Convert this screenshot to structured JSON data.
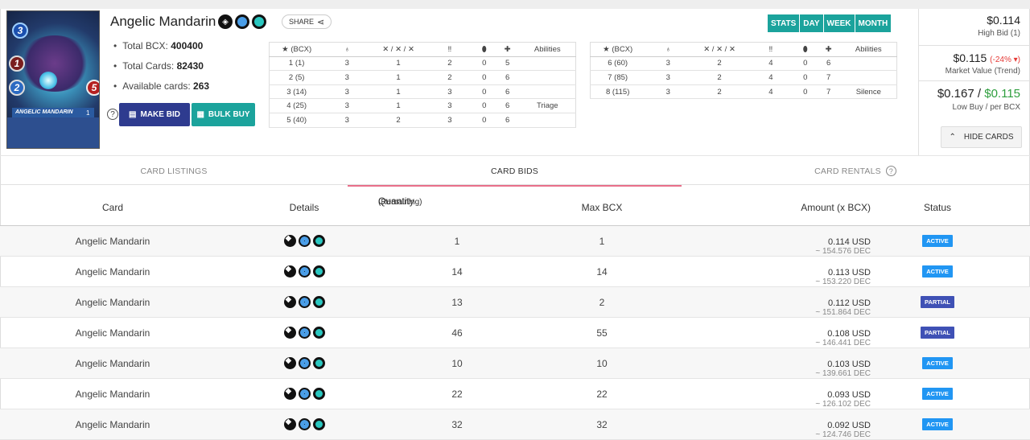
{
  "card": {
    "title": "Angelic Mandarin",
    "art_name": "ANGELIC MANDARIN",
    "art_mana": "3",
    "art_melee": "1",
    "art_speed": "2",
    "art_health": "5",
    "art_level": "1",
    "share_label": "SHARE",
    "total_bcx_label": "Total BCX:",
    "total_bcx": "400400",
    "total_cards_label": "Total Cards:",
    "total_cards": "82430",
    "available_label": "Available cards:",
    "available": "263",
    "make_bid_label": "MAKE BID",
    "bulk_buy_label": "BULK BUY"
  },
  "level_table_headers": [
    "(BCX)",
    "",
    "/ /",
    "",
    "",
    "",
    "Abilities"
  ],
  "level_table_1": [
    [
      "1 (1)",
      "3",
      "1",
      "2",
      "0",
      "5",
      ""
    ],
    [
      "2 (5)",
      "3",
      "1",
      "2",
      "0",
      "6",
      ""
    ],
    [
      "3 (14)",
      "3",
      "1",
      "3",
      "0",
      "6",
      ""
    ],
    [
      "4 (25)",
      "3",
      "1",
      "3",
      "0",
      "6",
      "Triage"
    ],
    [
      "5 (40)",
      "3",
      "2",
      "3",
      "0",
      "6",
      ""
    ]
  ],
  "level_table_2": [
    [
      "6 (60)",
      "3",
      "2",
      "4",
      "0",
      "6",
      ""
    ],
    [
      "7 (85)",
      "3",
      "2",
      "4",
      "0",
      "7",
      ""
    ],
    [
      "8 (115)",
      "3",
      "2",
      "4",
      "0",
      "7",
      "Silence"
    ]
  ],
  "periods": [
    "STATS",
    "DAY",
    "WEEK",
    "MONTH"
  ],
  "prices": {
    "high_bid": "$0.114",
    "high_bid_label": "High Bid (1)",
    "market_value": "$0.115",
    "market_trend": "(-24%",
    "market_label": "Market Value (Trend)",
    "low_buy": "$0.167",
    "low_buy_sep": "/",
    "per_bcx": "$0.115",
    "low_label": "Low Buy / per BCX",
    "hide_label": "HIDE CARDS"
  },
  "tabs": [
    "CARD LISTINGS",
    "CARD BIDS",
    "CARD RENTALS"
  ],
  "bids_headers": {
    "card": "Card",
    "details": "Details",
    "quantity": "Quantity",
    "remaining": "(Remaining)",
    "max_bcx": "Max BCX",
    "amount": "Amount (x BCX)",
    "status": "Status"
  },
  "bids": [
    {
      "card": "Angelic Mandarin",
      "qty": "1",
      "max": "1",
      "usd": "0.114 USD",
      "dec": "~ 154.576 DEC",
      "status": "ACTIVE"
    },
    {
      "card": "Angelic Mandarin",
      "qty": "14",
      "max": "14",
      "usd": "0.113 USD",
      "dec": "~ 153.220 DEC",
      "status": "ACTIVE"
    },
    {
      "card": "Angelic Mandarin",
      "qty": "13",
      "max": "2",
      "usd": "0.112 USD",
      "dec": "~ 151.864 DEC",
      "status": "PARTIAL"
    },
    {
      "card": "Angelic Mandarin",
      "qty": "46",
      "max": "55",
      "usd": "0.108 USD",
      "dec": "~ 146.441 DEC",
      "status": "PARTIAL"
    },
    {
      "card": "Angelic Mandarin",
      "qty": "10",
      "max": "10",
      "usd": "0.103 USD",
      "dec": "~ 139.661 DEC",
      "status": "ACTIVE"
    },
    {
      "card": "Angelic Mandarin",
      "qty": "22",
      "max": "22",
      "usd": "0.093 USD",
      "dec": "~ 126.102 DEC",
      "status": "ACTIVE"
    },
    {
      "card": "Angelic Mandarin",
      "qty": "32",
      "max": "32",
      "usd": "0.092 USD",
      "dec": "~ 124.746 DEC",
      "status": "ACTIVE"
    }
  ]
}
